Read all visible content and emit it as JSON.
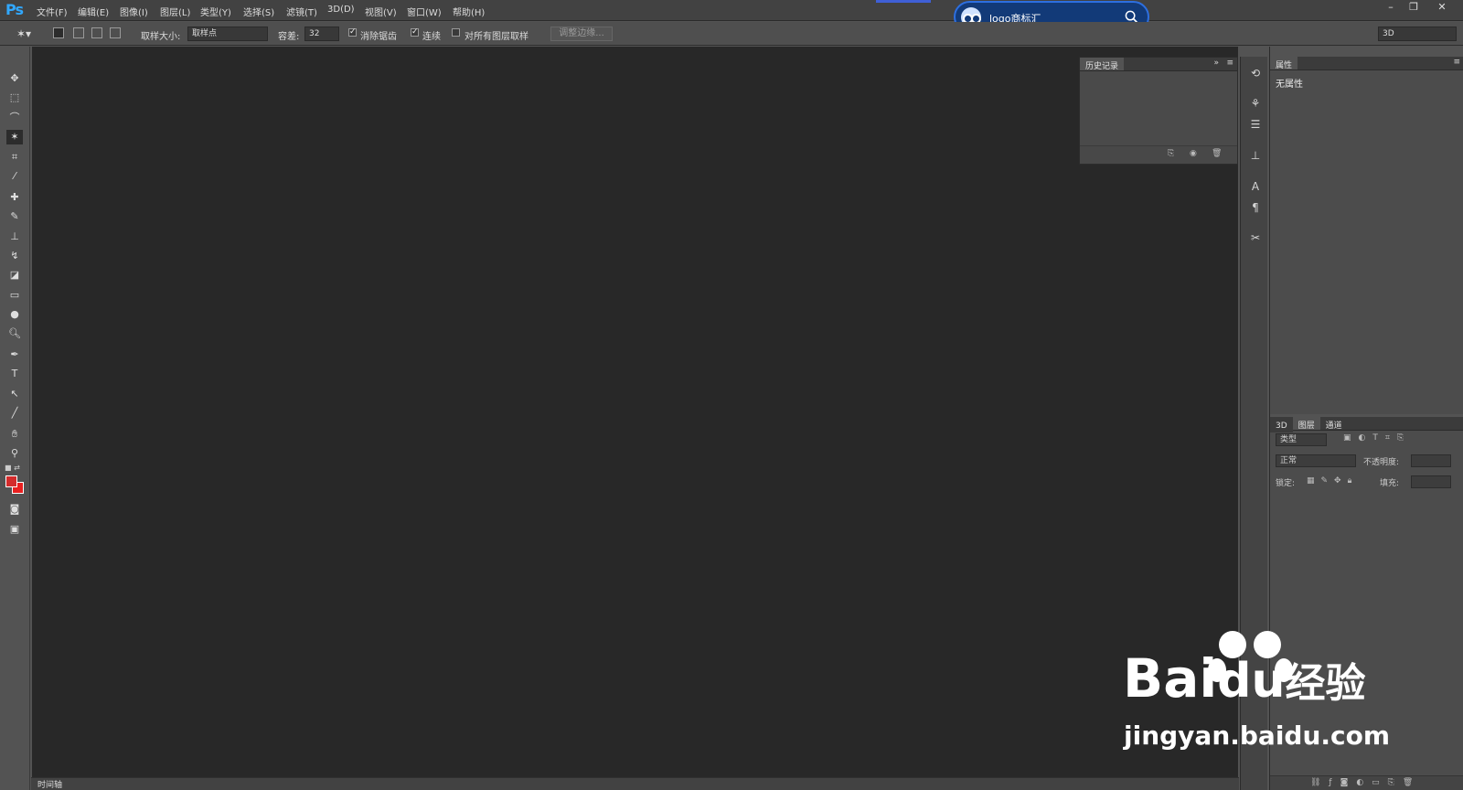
{
  "app": {
    "logo": "Ps"
  },
  "menu": [
    "文件(F)",
    "编辑(E)",
    "图像(I)",
    "图层(L)",
    "类型(Y)",
    "选择(S)",
    "滤镜(T)",
    "3D(D)",
    "视图(V)",
    "窗口(W)",
    "帮助(H)"
  ],
  "window_controls": {
    "minimize": "–",
    "restore": "❐",
    "close": "✕"
  },
  "search": {
    "text": "logo商标汇"
  },
  "options": {
    "sample_size_label": "取样大小:",
    "sample_size_value": "取样点",
    "tolerance_label": "容差:",
    "tolerance_value": "32",
    "antialias_label": "消除锯齿",
    "contiguous_label": "连续",
    "sample_all_label": "对所有图层取样",
    "refine_edge_label": "调整边缘...",
    "workspace_value": "3D"
  },
  "panels": {
    "history_tab": "历史记录",
    "properties_tab": "属性",
    "properties_empty": "无属性",
    "layers_tabs": [
      "3D",
      "图层",
      "通道"
    ],
    "kind_filter": "类型",
    "blend_mode": "正常",
    "opacity_label": "不透明度:",
    "lock_label": "锁定:",
    "fill_label": "填充:",
    "timeline_tab": "时间轴"
  },
  "colors": {
    "foreground": "#d42c2c",
    "background": "#e82020"
  },
  "watermark": {
    "brand": "Bai",
    "brand_suffix": "经验",
    "url": "jingyan.baidu.com"
  }
}
